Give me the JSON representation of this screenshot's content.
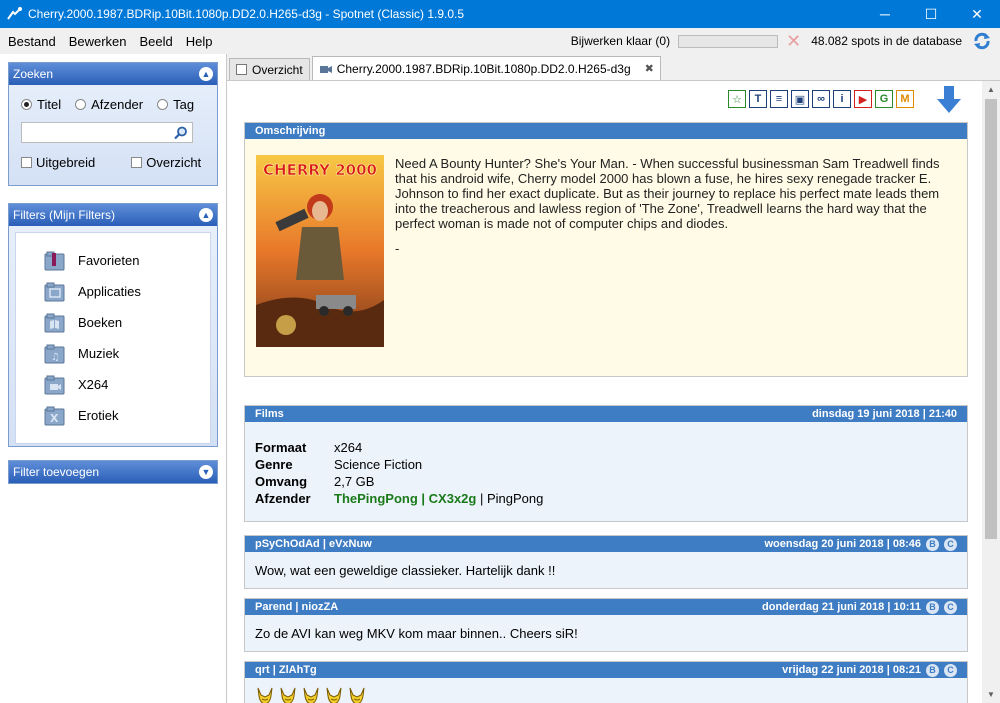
{
  "window": {
    "title": "Cherry.2000.1987.BDRip.10Bit.1080p.DD2.0.H265-d3g - Spotnet (Classic) 1.9.0.5",
    "controls": [
      "─",
      "☐",
      "✕"
    ]
  },
  "menu": {
    "items": [
      "Bestand",
      "Bewerken",
      "Beeld",
      "Help"
    ],
    "status_text": "Bijwerken klaar (0)",
    "progress": 0,
    "spots_text": "48.082 spots in de database"
  },
  "sidebar": {
    "search": {
      "header": "Zoeken",
      "radios": [
        {
          "label": "Titel",
          "selected": true
        },
        {
          "label": "Afzender",
          "selected": false
        },
        {
          "label": "Tag",
          "selected": false
        }
      ],
      "value": "",
      "checks": [
        {
          "label": "Uitgebreid",
          "checked": false
        },
        {
          "label": "Overzicht",
          "checked": false
        }
      ]
    },
    "filters": {
      "header": "Filters (Mijn Filters)",
      "items": [
        {
          "label": "Favorieten",
          "icon": "favorites-folder-icon"
        },
        {
          "label": "Applicaties",
          "icon": "applications-folder-icon"
        },
        {
          "label": "Boeken",
          "icon": "books-folder-icon"
        },
        {
          "label": "Muziek",
          "icon": "music-folder-icon"
        },
        {
          "label": "X264",
          "icon": "video-folder-icon"
        },
        {
          "label": "Erotiek",
          "icon": "erotic-folder-icon"
        }
      ]
    },
    "add_filter": {
      "header": "Filter toevoegen"
    }
  },
  "tabs": [
    {
      "label": "Overzicht",
      "active": false
    },
    {
      "label": "Cherry.2000.1987.BDRip.10Bit.1080p.DD2.0.H265-d3g",
      "active": true
    }
  ],
  "toolbar_icons": [
    {
      "glyph": "☆",
      "name": "favorite-icon",
      "color": "#2a8a2a"
    },
    {
      "glyph": "T",
      "name": "title-icon",
      "color": "#1e3f7a"
    },
    {
      "glyph": "≡",
      "name": "description-icon",
      "color": "#1e3f7a"
    },
    {
      "glyph": "▣",
      "name": "image-icon",
      "color": "#1e3f7a"
    },
    {
      "glyph": "∞",
      "name": "link-icon",
      "color": "#1e3f7a"
    },
    {
      "glyph": "i",
      "name": "info-icon",
      "color": "#1e3f7a"
    },
    {
      "glyph": "▶",
      "name": "youtube-icon",
      "color": "#d52020"
    },
    {
      "glyph": "G",
      "name": "google-icon",
      "color": "#2a8a2a"
    },
    {
      "glyph": "M",
      "name": "imdb-icon",
      "color": "#e08a00"
    }
  ],
  "description": {
    "header": "Omschrijving",
    "text": "Need A Bounty Hunter? She's Your Man. - When successful businessman Sam Treadwell finds that his android wife, Cherry model 2000 has blown a fuse, he hires sexy renegade tracker E. Johnson to find her exact duplicate. But as their journey to replace his perfect mate leads them into the treacherous and lawless region of 'The Zone', Treadwell learns the hard way that the perfect woman is made not of computer chips and diodes.",
    "trailer": "-",
    "poster_title": "CHERRY 2000"
  },
  "info": {
    "header": "Films",
    "date": "dinsdag 19 juni 2018 | 21:40",
    "rows": [
      {
        "key": "Formaat",
        "value": "x264"
      },
      {
        "key": "Genre",
        "value": "Science Fiction"
      },
      {
        "key": "Omvang",
        "value": "2,7 GB"
      }
    ],
    "sender_key": "Afzender",
    "sender_name": "ThePingPong",
    "sender_sep": " | ",
    "sender_id": "CX3x2g",
    "sender_nick": "PingPong"
  },
  "comments": [
    {
      "author": "pSyChOdAd | eVxNuw",
      "date": "woensdag 20 juni 2018 | 08:46",
      "text": "Wow, wat een geweldige classieker. Hartelijk dank !!"
    },
    {
      "author": "Parend | niozZA",
      "date": "donderdag 21 juni 2018 | 10:11",
      "text": "Zo de AVI kan weg MKV kom maar binnen.. Cheers siR!"
    },
    {
      "author": "qrt | ZlAhTg",
      "date": "vrijdag 22 juni 2018 | 08:21",
      "text": ""
    }
  ],
  "comment_badges": [
    "B",
    "C"
  ],
  "emoji_count": 5
}
